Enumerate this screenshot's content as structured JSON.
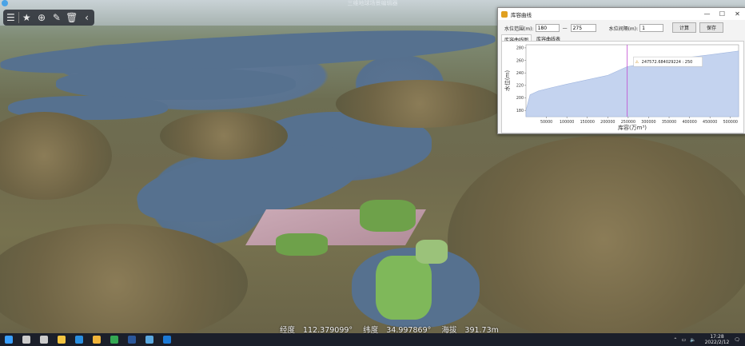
{
  "app": {
    "title": "三维地球场景编辑器"
  },
  "toolbar": {
    "buttons": [
      {
        "icon": "list-icon",
        "glyph": "☰"
      },
      {
        "icon": "star-icon",
        "glyph": "★"
      },
      {
        "icon": "target-icon",
        "glyph": "⊕"
      },
      {
        "icon": "pencil-icon",
        "glyph": "✎"
      },
      {
        "icon": "trash-icon",
        "glyph": "🗑"
      },
      {
        "icon": "chevron-left-icon",
        "glyph": "‹"
      }
    ]
  },
  "status": {
    "longitude_label": "经度",
    "longitude": "112.379099°",
    "latitude_label": "纬度",
    "latitude": "34.997869°",
    "elevation_label": "海拔",
    "elevation": "391.73m"
  },
  "dialog": {
    "title": "库容曲线",
    "range_label": "水位范围(m):",
    "range_min": "180",
    "range_sep": "—",
    "range_max": "275",
    "interval_label": "水位间隔(m):",
    "interval": "1",
    "calc_label": "计算",
    "save_label": "保存",
    "tabs": [
      "库容曲线图",
      "库容曲线表"
    ],
    "active_tab": 0
  },
  "chart_data": {
    "type": "area",
    "title": "",
    "xlabel": "库容(万m³)",
    "ylabel": "水位(m)",
    "xlim": [
      0,
      520000
    ],
    "ylim": [
      170,
      285
    ],
    "xticks": [
      50000,
      100000,
      150000,
      200000,
      250000,
      300000,
      350000,
      400000,
      450000,
      500000
    ],
    "yticks": [
      180,
      200,
      220,
      240,
      260,
      280
    ],
    "series": [
      {
        "x": [
          0,
          10000,
          30000,
          60000,
          100000,
          150000,
          200000,
          247572,
          300000,
          350000,
          400000,
          450000,
          520000
        ],
        "y": [
          180,
          205,
          211,
          216,
          222,
          229,
          236,
          250,
          256,
          261,
          265,
          269,
          275
        ],
        "color": "#c4d3ef"
      }
    ],
    "cursor": {
      "x": 247572,
      "label": "247572.684029224 : 250",
      "color": "#c04ad0"
    },
    "grid": false
  },
  "taskbar": {
    "time": "17:28",
    "date": "2022/2/12",
    "items": [
      {
        "icon": "windows-start-icon",
        "color": "#3aa0ff"
      },
      {
        "icon": "search-icon",
        "color": "#cccccc"
      },
      {
        "icon": "task-view-icon",
        "color": "#cccccc"
      },
      {
        "icon": "explorer-icon",
        "color": "#f4c542"
      },
      {
        "icon": "edge-icon",
        "color": "#2a8fe0"
      },
      {
        "icon": "folder-icon",
        "color": "#f0b43a"
      },
      {
        "icon": "chrome-icon",
        "color": "#34a853"
      },
      {
        "icon": "word-icon",
        "color": "#2b579a"
      },
      {
        "icon": "globe-app-icon",
        "color": "#5aa8e0"
      },
      {
        "icon": "app-icon",
        "color": "#1c7ad6"
      }
    ]
  }
}
